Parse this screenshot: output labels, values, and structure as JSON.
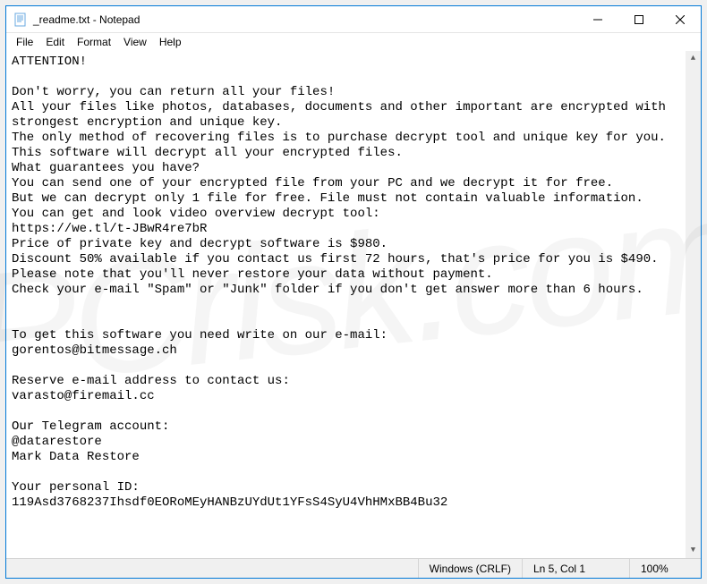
{
  "window": {
    "title": "_readme.txt - Notepad"
  },
  "menu": {
    "file": "File",
    "edit": "Edit",
    "format": "Format",
    "view": "View",
    "help": "Help"
  },
  "content": {
    "text": "ATTENTION!\n\nDon't worry, you can return all your files!\nAll your files like photos, databases, documents and other important are encrypted with strongest encryption and unique key.\nThe only method of recovering files is to purchase decrypt tool and unique key for you.\nThis software will decrypt all your encrypted files.\nWhat guarantees you have?\nYou can send one of your encrypted file from your PC and we decrypt it for free.\nBut we can decrypt only 1 file for free. File must not contain valuable information.\nYou can get and look video overview decrypt tool:\nhttps://we.tl/t-JBwR4re7bR\nPrice of private key and decrypt software is $980.\nDiscount 50% available if you contact us first 72 hours, that's price for you is $490.\nPlease note that you'll never restore your data without payment.\nCheck your e-mail \"Spam\" or \"Junk\" folder if you don't get answer more than 6 hours.\n\n\nTo get this software you need write on our e-mail:\ngorentos@bitmessage.ch\n\nReserve e-mail address to contact us:\nvarasto@firemail.cc\n\nOur Telegram account:\n@datarestore\nMark Data Restore\n\nYour personal ID:\n119Asd3768237Ihsdf0EORoMEyHANBzUYdUt1YFsS4SyU4VhHMxBB4Bu32"
  },
  "statusbar": {
    "encoding": "Windows (CRLF)",
    "position": "Ln 5, Col 1",
    "zoom": "100%"
  },
  "watermark": "PCrisk.com"
}
